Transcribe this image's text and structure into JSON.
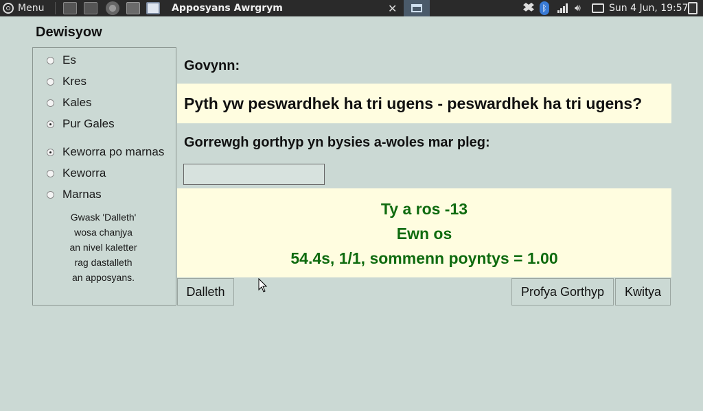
{
  "taskbar": {
    "menu_label": "Menu",
    "window_title": "Apposyans Awrgrym",
    "close_glyph": "✕",
    "clock": "Sun  4 Jun, 19:57",
    "launchers": [
      "monitor-icon",
      "monitor-icon",
      "browser-icon",
      "files-icon",
      "window-icon"
    ],
    "tray_icons": [
      "dropbox-icon",
      "bluetooth-icon",
      "network-icon",
      "volume-icon",
      "battery-icon",
      "power-icon"
    ]
  },
  "settings": {
    "title": "Dewisyow",
    "difficulty": [
      {
        "label": "Es",
        "checked": false
      },
      {
        "label": "Kres",
        "checked": false
      },
      {
        "label": "Kales",
        "checked": false
      },
      {
        "label": "Pur Gales",
        "checked": true
      }
    ],
    "range": [
      {
        "label": "Keworra po marnas",
        "checked": true
      },
      {
        "label": "Keworra",
        "checked": false
      },
      {
        "label": "Marnas",
        "checked": false
      }
    ],
    "hint_lines": [
      "Gwask 'Dalleth'",
      "wosa chanjya",
      "an nivel kaletter",
      "rag dastalleth",
      "an apposyans."
    ]
  },
  "main": {
    "question_label": "Govynn:",
    "question": "Pyth yw peswardhek ha tri ugens - peswardhek ha tri ugens?",
    "prompt": "Gorrewgh gorthyp yn bysies a-woles mar pleg:",
    "answer_value": "",
    "feedback": {
      "line1": "Ty a ros -13",
      "line2": "Ewn os",
      "line3": "54.4s, 1/1, sommenn poyntys = 1.00",
      "color": "#0f6b0f"
    },
    "buttons": {
      "start": "Dalleth",
      "check": "Profya Gorthyp",
      "quit": "Kwitya"
    }
  }
}
